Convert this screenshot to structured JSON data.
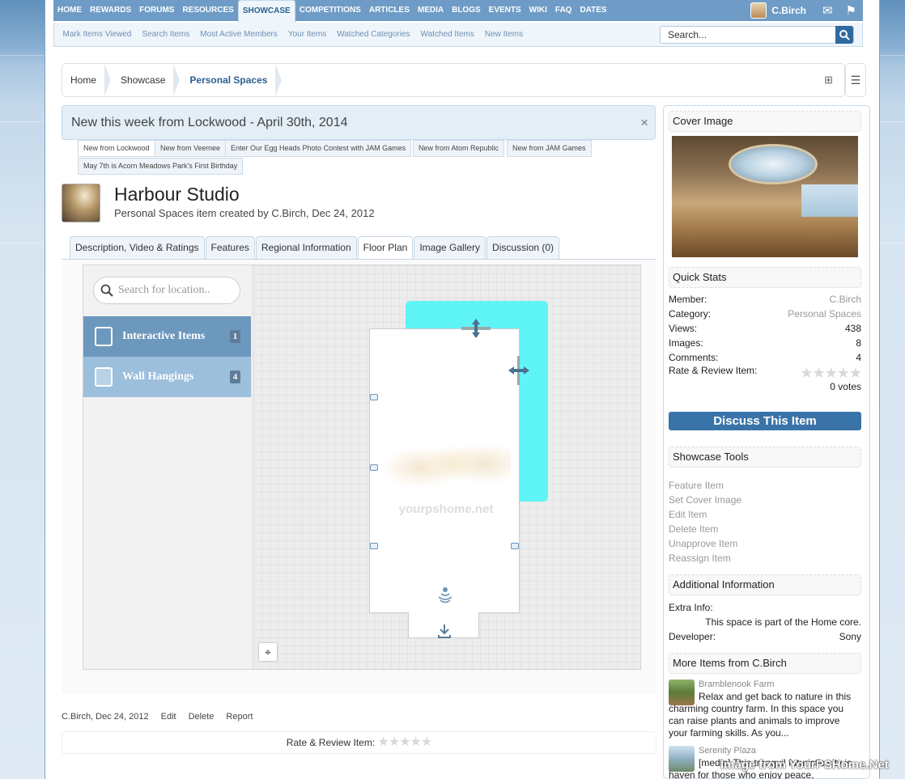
{
  "nav": {
    "tabs": [
      "HOME",
      "REWARDS",
      "FORUMS",
      "RESOURCES",
      "SHOWCASE",
      "COMPETITIONS",
      "ARTICLES",
      "MEDIA",
      "BLOGS",
      "EVENTS",
      "WIKI",
      "FAQ",
      "DATES"
    ],
    "selected": "SHOWCASE",
    "user": "C.Birch"
  },
  "subnav": {
    "links": [
      "Mark Items Viewed",
      "Search Items",
      "Most Active Members",
      "Your Items",
      "Watched Categories",
      "Watched Items",
      "New Items"
    ],
    "search_placeholder": "Search..."
  },
  "breadcrumb": [
    "Home",
    "Showcase",
    "Personal Spaces"
  ],
  "notice": {
    "title": "New this week from Lockwood - April 30th, 2014",
    "close": "×",
    "tabs": [
      "New from Lockwood",
      "New from Veemee",
      "Enter Our Egg Heads Photo Contest with JAM Games",
      "New from Atom Republic",
      "New from JAM Games",
      "May 7th is Acorn Meadows Park's First Birthday"
    ]
  },
  "item": {
    "title": "Harbour Studio",
    "subtitle": "Personal Spaces item created by C.Birch, Dec 24, 2012"
  },
  "tabs": [
    "Description, Video & Ratings",
    "Features",
    "Regional Information",
    "Floor Plan",
    "Image Gallery",
    "Discussion (0)"
  ],
  "active_tab": "Floor Plan",
  "map": {
    "search_placeholder": "Search for location..",
    "categories": [
      {
        "label": "Interactive Items",
        "count": "1"
      },
      {
        "label": "Wall Hangings",
        "count": "4"
      }
    ],
    "watermark": "yourpshome.net"
  },
  "footer": {
    "author_date": "C.Birch, Dec 24, 2012",
    "actions": [
      "Edit",
      "Delete",
      "Report"
    ],
    "rate_label": "Rate & Review Item:",
    "stars": "★★★★★"
  },
  "sidebar": {
    "cover_title": "Cover Image",
    "quick_stats_title": "Quick Stats",
    "stats": [
      {
        "k": "Member:",
        "v": "C.Birch"
      },
      {
        "k": "Category:",
        "v": "Personal Spaces"
      },
      {
        "k": "Views:",
        "v": "438"
      },
      {
        "k": "Images:",
        "v": "8"
      },
      {
        "k": "Comments:",
        "v": "4"
      }
    ],
    "rate_label": "Rate & Review Item:",
    "votes": "0 votes",
    "stars": "★★★★★",
    "discuss": "Discuss This Item",
    "tools_title": "Showcase Tools",
    "tools": [
      "Feature Item",
      "Set Cover Image",
      "Edit Item",
      "Delete Item",
      "Unapprove Item",
      "Reassign Item"
    ],
    "additional_title": "Additional Information",
    "extra_label": "Extra Info:",
    "extra_value": "This space is part of the Home core.",
    "dev_label": "Developer:",
    "dev_value": "Sony",
    "more_title": "More Items from C.Birch",
    "more": [
      {
        "name": "Bramblenook Farm",
        "desc": "Relax and get back to nature in this charming country farm. In this space you can raise plants and animals to improve your farming skills. As you..."
      },
      {
        "name": "Serenity Plaza",
        "desc": "[media] This tranquil futuristic city is haven for those who enjoy peace,"
      }
    ]
  },
  "watermark": "Image from YourPSHome.Net",
  "colors": {
    "nav": "#6e9cc6",
    "accent": "#2b5f90",
    "button": "#3a73a8",
    "cyan_area": "#5ff4f6"
  }
}
